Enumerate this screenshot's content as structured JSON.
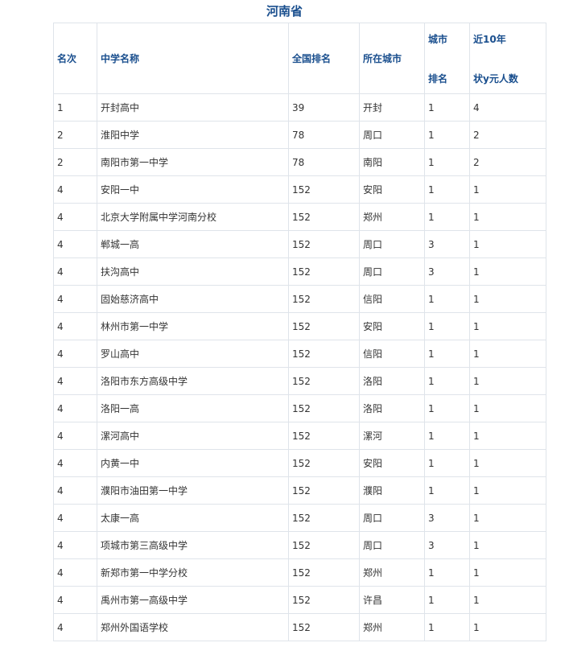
{
  "title": "河南省",
  "headers": {
    "rank": "名次",
    "school": "中学名称",
    "national_rank": "全国排名",
    "city": "所在城市",
    "city_rank_top": "城市",
    "city_rank_bottom": "排名",
    "count_top": "近10年",
    "count_bottom": "状y元人数"
  },
  "rows": [
    {
      "rank": "1",
      "school": "开封高中",
      "national_rank": "39",
      "city": "开封",
      "city_rank": "1",
      "count": "4"
    },
    {
      "rank": "2",
      "school": "淮阳中学",
      "national_rank": "78",
      "city": "周口",
      "city_rank": "1",
      "count": "2"
    },
    {
      "rank": "2",
      "school": "南阳市第一中学",
      "national_rank": "78",
      "city": "南阳",
      "city_rank": "1",
      "count": "2"
    },
    {
      "rank": "4",
      "school": "安阳一中",
      "national_rank": "152",
      "city": "安阳",
      "city_rank": "1",
      "count": "1"
    },
    {
      "rank": "4",
      "school": "北京大学附属中学河南分校",
      "national_rank": "152",
      "city": "郑州",
      "city_rank": "1",
      "count": "1"
    },
    {
      "rank": "4",
      "school": "郸城一高",
      "national_rank": "152",
      "city": "周口",
      "city_rank": "3",
      "count": "1"
    },
    {
      "rank": "4",
      "school": "扶沟高中",
      "national_rank": "152",
      "city": "周口",
      "city_rank": "3",
      "count": "1"
    },
    {
      "rank": "4",
      "school": "固始慈济高中",
      "national_rank": "152",
      "city": "信阳",
      "city_rank": "1",
      "count": "1"
    },
    {
      "rank": "4",
      "school": "林州市第一中学",
      "national_rank": "152",
      "city": "安阳",
      "city_rank": "1",
      "count": "1"
    },
    {
      "rank": "4",
      "school": "罗山高中",
      "national_rank": "152",
      "city": "信阳",
      "city_rank": "1",
      "count": "1"
    },
    {
      "rank": "4",
      "school": "洛阳市东方高级中学",
      "national_rank": "152",
      "city": "洛阳",
      "city_rank": "1",
      "count": "1"
    },
    {
      "rank": "4",
      "school": "洛阳一高",
      "national_rank": "152",
      "city": "洛阳",
      "city_rank": "1",
      "count": "1"
    },
    {
      "rank": "4",
      "school": "漯河高中",
      "national_rank": "152",
      "city": "漯河",
      "city_rank": "1",
      "count": "1"
    },
    {
      "rank": "4",
      "school": "内黄一中",
      "national_rank": "152",
      "city": "安阳",
      "city_rank": "1",
      "count": "1"
    },
    {
      "rank": "4",
      "school": "濮阳市油田第一中学",
      "national_rank": "152",
      "city": "濮阳",
      "city_rank": "1",
      "count": "1"
    },
    {
      "rank": "4",
      "school": "太康一高",
      "national_rank": "152",
      "city": "周口",
      "city_rank": "3",
      "count": "1"
    },
    {
      "rank": "4",
      "school": "项城市第三高级中学",
      "national_rank": "152",
      "city": "周口",
      "city_rank": "3",
      "count": "1"
    },
    {
      "rank": "4",
      "school": "新郑市第一中学分校",
      "national_rank": "152",
      "city": "郑州",
      "city_rank": "1",
      "count": "1"
    },
    {
      "rank": "4",
      "school": "禹州市第一高级中学",
      "national_rank": "152",
      "city": "许昌",
      "city_rank": "1",
      "count": "1"
    },
    {
      "rank": "4",
      "school": "郑州外国语学校",
      "national_rank": "152",
      "city": "郑州",
      "city_rank": "1",
      "count": "1"
    }
  ]
}
